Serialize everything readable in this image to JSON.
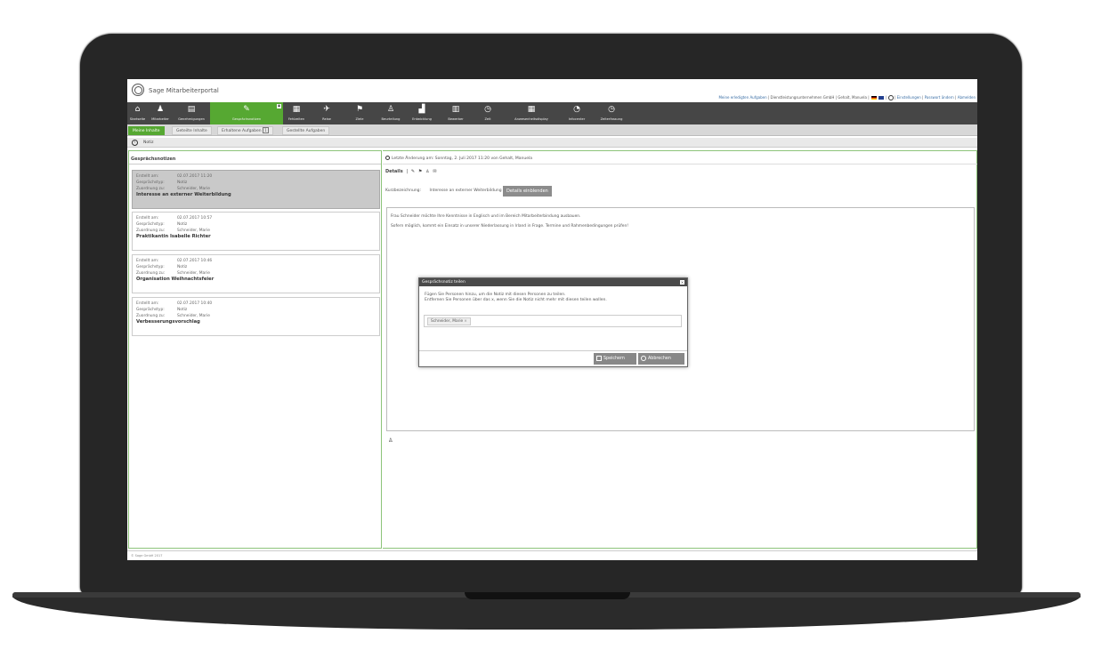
{
  "app": {
    "title": "Sage Mitarbeiterportal",
    "top_links": {
      "open_tasks": "Meine erledigten Aufgaben",
      "company": "Dienstleistungsunternehmen GmbH",
      "user": "Gehalt, Manuela",
      "settings": "Einstellungen",
      "change_password": "Passwort ändern",
      "logout": "Abmelden"
    }
  },
  "nav": {
    "items": [
      {
        "label": "Startseite",
        "icon": "home-icon",
        "glyph": "⌂"
      },
      {
        "label": "Mitarbeiter",
        "icon": "person-icon",
        "glyph": "♟"
      },
      {
        "label": "Genehmigungen",
        "icon": "document-icon",
        "glyph": "▤"
      },
      {
        "label": "Gesprächsnotizen",
        "icon": "notes-icon",
        "glyph": "✎",
        "badge": "▣"
      },
      {
        "label": "Fehlzeiten",
        "icon": "calendar-icon",
        "glyph": "▦"
      },
      {
        "label": "Reise",
        "icon": "plane-icon",
        "glyph": "✈"
      },
      {
        "label": "Ziele",
        "icon": "flag-icon",
        "glyph": "⚑"
      },
      {
        "label": "Beurteilung",
        "icon": "people-icon",
        "glyph": "♙"
      },
      {
        "label": "Entwicklung",
        "icon": "chart-icon",
        "glyph": "▟"
      },
      {
        "label": "Bewerber",
        "icon": "books-icon",
        "glyph": "▥"
      },
      {
        "label": "Zeit",
        "icon": "time-calendar-icon",
        "glyph": "◷"
      },
      {
        "label": "Anwesenheitsdisplay",
        "icon": "grid-icon",
        "glyph": "▦"
      },
      {
        "label": "Infocenter",
        "icon": "pie-icon",
        "glyph": "◔"
      },
      {
        "label": "Zeiterfassung",
        "icon": "clock-calendar-icon",
        "glyph": "◷"
      }
    ]
  },
  "tabs": {
    "my_content": "Meine Inhalte",
    "shared_content": "Geteilte Inhalte",
    "received_tasks": "Erhaltene Aufgaben",
    "received_tasks_count": "1",
    "assigned_tasks": "Gestellte Aufgaben"
  },
  "breadcrumb": {
    "label": "Notiz"
  },
  "left": {
    "title": "Gesprächsnotizen",
    "labels": {
      "created": "Erstellt am:",
      "type": "Gesprächstyp:",
      "assigned": "Zuordnung zu:"
    },
    "notes": [
      {
        "created": "02.07.2017 11:20",
        "type": "Notiz",
        "assigned": "Schneider, Marie",
        "title": "Interesse an externer Weiterbildung"
      },
      {
        "created": "02.07.2017 10:57",
        "type": "Notiz",
        "assigned": "Schneider, Marie",
        "title": "Praktikantin Isabelle Richter"
      },
      {
        "created": "02.07.2017 10:46",
        "type": "Notiz",
        "assigned": "Schneider, Marie",
        "title": "Organisation Weihnachtsfeier"
      },
      {
        "created": "02.07.2017 10:40",
        "type": "Notiz",
        "assigned": "Schneider, Marie",
        "title": "Verbesserungsvorschlag"
      }
    ]
  },
  "right": {
    "last_modified": "Letzte Änderung am: Sonntag, 2. Juli 2017 11:20 von Gehalt, Manuela",
    "details_label": "Details",
    "short_label": "Kurzbezeichnung:",
    "short_value": "Interesse an externer Weiterbildung",
    "show_details_btn": "Details einblenden",
    "note_lines": [
      "Frau Schneider möchte Ihre Kenntnisse in Englisch und im Bereich Mitarbeiterbindung ausbauen.",
      "Sofern möglich, kommt ein Einsatz in unserer Niederlassung in Irland in Frage. Termine und Rahmenbedingungen prüfen!"
    ]
  },
  "dialog": {
    "title": "Gesprächsnotiz teilen",
    "line1": "Fügen Sie Personen hinzu, um die Notiz mit diesen Personen zu teilen.",
    "line2": "Entfernen Sie Personen über das x, wenn Sie die Notiz nicht mehr mit diesen teilen wollen.",
    "tag": "Schneider, Marie",
    "save": "Speichern",
    "cancel": "Abbrechen"
  },
  "footer": {
    "text": "© Sage GmbH 2017"
  },
  "colors": {
    "accent": "#56a832",
    "nav_bg": "#464646"
  }
}
